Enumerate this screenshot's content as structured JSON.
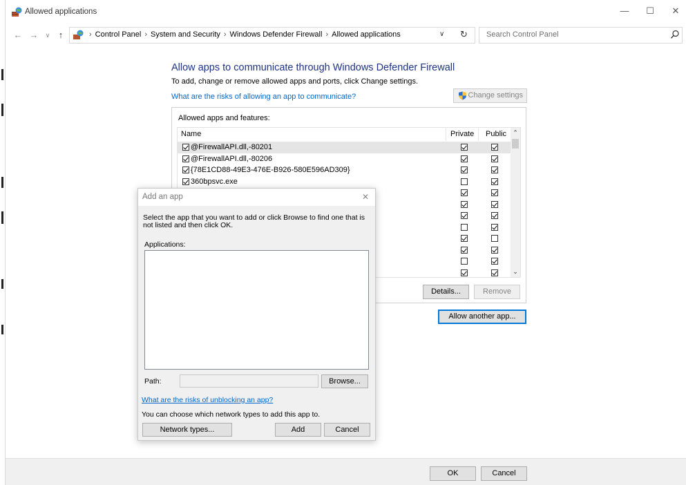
{
  "window": {
    "title": "Allowed applications",
    "minimize": "—",
    "maximize": "☐",
    "close": "✕"
  },
  "nav": {
    "back": "←",
    "forward": "→",
    "recent": "∨",
    "up": "↑",
    "dropdown": "∨",
    "refresh": "↻"
  },
  "breadcrumb": [
    "Control Panel",
    "System and Security",
    "Windows Defender Firewall",
    "Allowed applications"
  ],
  "search": {
    "placeholder": "Search Control Panel"
  },
  "main": {
    "title": "Allow apps to communicate through Windows Defender Firewall",
    "subtitle": "To add, change or remove allowed apps and ports, click Change settings.",
    "risk_link": "What are the risks of allowing an app to communicate?",
    "change_settings": "Change settings",
    "group_label": "Allowed apps and features:",
    "columns": {
      "name": "Name",
      "private": "Private",
      "public": "Public"
    },
    "apps": [
      {
        "name": "@FirewallAPI.dll,-80201",
        "enabled": true,
        "private": true,
        "public": true,
        "selected": true
      },
      {
        "name": "@FirewallAPI.dll,-80206",
        "enabled": true,
        "private": true,
        "public": true
      },
      {
        "name": "{78E1CD88-49E3-476E-B926-580E596AD309}",
        "enabled": true,
        "private": true,
        "public": true
      },
      {
        "name": "360bpsvc.exe",
        "enabled": true,
        "private": false,
        "public": true
      },
      {
        "name": "",
        "enabled": true,
        "private": true,
        "public": true
      },
      {
        "name": "",
        "enabled": true,
        "private": true,
        "public": true
      },
      {
        "name": "",
        "enabled": true,
        "private": true,
        "public": true
      },
      {
        "name": "",
        "enabled": true,
        "private": false,
        "public": true
      },
      {
        "name": "",
        "enabled": true,
        "private": true,
        "public": false
      },
      {
        "name": "",
        "enabled": true,
        "private": true,
        "public": true
      },
      {
        "name": "",
        "enabled": true,
        "private": false,
        "public": true
      },
      {
        "name": "",
        "enabled": true,
        "private": true,
        "public": true
      }
    ],
    "details_button": "Details...",
    "remove_button": "Remove",
    "allow_another_button": "Allow another app..."
  },
  "footer": {
    "ok": "OK",
    "cancel": "Cancel"
  },
  "dialog": {
    "title": "Add an app",
    "close": "✕",
    "description": "Select the app that you want to add or click Browse to find one that is not listed and then click OK.",
    "applications_label": "Applications:",
    "path_label": "Path:",
    "browse_button": "Browse...",
    "risk_link": "What are the risks of unblocking an app?",
    "network_text": "You can choose which network types to add this app to.",
    "network_types_button": "Network types...",
    "add_button": "Add",
    "cancel_button": "Cancel"
  }
}
